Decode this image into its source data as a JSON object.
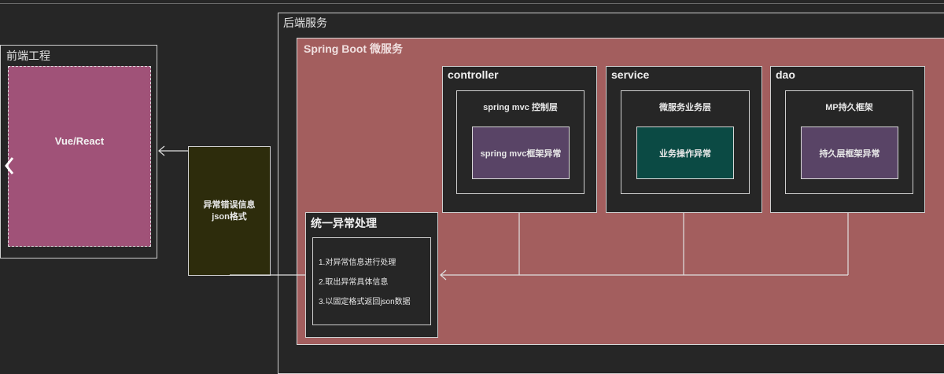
{
  "frontend": {
    "title": "前端工程",
    "app": "Vue/React"
  },
  "message": {
    "line1": "异常错误信息",
    "line2": "json格式"
  },
  "backend": {
    "title": "后端服务",
    "microservice": "Spring Boot 微服务",
    "layers": [
      {
        "name": "controller",
        "inner": "spring mvc 控制层",
        "exception": "spring mvc框架异常"
      },
      {
        "name": "service",
        "inner": "微服务业务层",
        "exception": "业务操作异常"
      },
      {
        "name": "dao",
        "inner": "MP持久框架",
        "exception": "持久层框架异常"
      }
    ],
    "handler": {
      "title": "统一异常处理",
      "steps": [
        "1.对异常信息进行处理",
        "2.取出异常具体信息",
        "3.以固定格式返回json数据"
      ]
    }
  },
  "colors": {
    "background": "#262626",
    "spring_box": "#a35e5e",
    "frontend_app": "#a05278",
    "message_box": "#2d2c0c",
    "spring_exception": "#594466",
    "business_exception": "#0b4a44",
    "dao_exception": "#594466"
  },
  "icons": {
    "left_arrow": "chevron-left-icon"
  }
}
